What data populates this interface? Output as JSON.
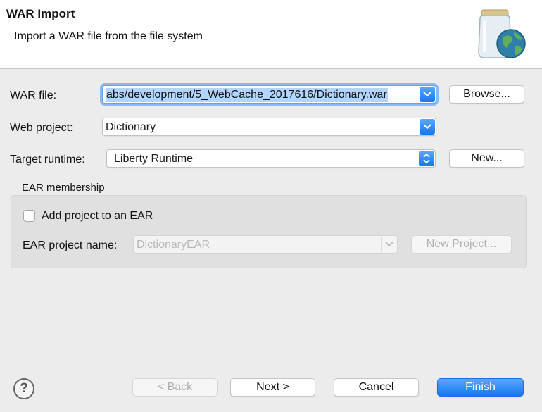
{
  "header": {
    "title": "WAR Import",
    "description": "Import a WAR file from the file system",
    "icon": "jar-globe-icon"
  },
  "form": {
    "war_file_label": "WAR file:",
    "war_file_value": "abs/development/5_WebCache_2017616/Dictionary.war",
    "browse_label": "Browse...",
    "web_project_label": "Web project:",
    "web_project_value": "Dictionary",
    "target_runtime_label": "Target runtime:",
    "target_runtime_value": "Liberty Runtime",
    "new_label": "New..."
  },
  "ear": {
    "group_label": "EAR membership",
    "add_checkbox_label": "Add project to an EAR",
    "add_checked": false,
    "project_name_label": "EAR project name:",
    "project_name_value": "DictionaryEAR",
    "new_project_label": "New Project..."
  },
  "footer": {
    "help_icon": "help-icon",
    "help_glyph": "?",
    "back_label": "< Back",
    "next_label": "Next >",
    "cancel_label": "Cancel",
    "finish_label": "Finish"
  },
  "colors": {
    "accent": "#1676f3",
    "selection": "#b3d4fc",
    "dialog_bg": "#ececec"
  }
}
